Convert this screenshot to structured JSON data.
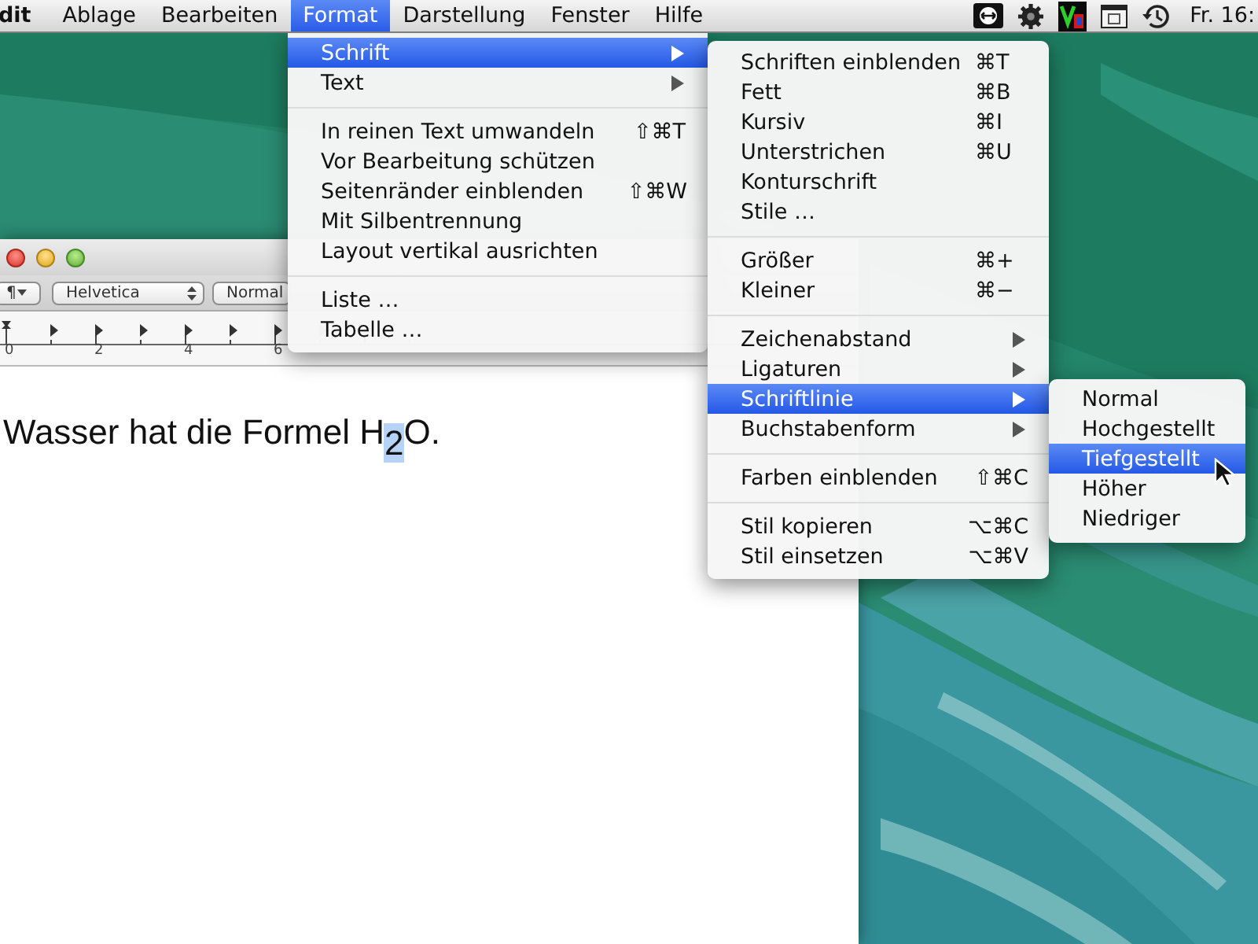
{
  "menubar": {
    "items": [
      {
        "label": "dit",
        "kind": "app",
        "selected": false
      },
      {
        "label": "Ablage",
        "kind": "menu",
        "selected": false
      },
      {
        "label": "Bearbeiten",
        "kind": "menu",
        "selected": false
      },
      {
        "label": "Format",
        "kind": "menu",
        "selected": true
      },
      {
        "label": "Darstellung",
        "kind": "menu",
        "selected": false
      },
      {
        "label": "Fenster",
        "kind": "menu",
        "selected": false
      },
      {
        "label": "Hilfe",
        "kind": "menu",
        "selected": false
      }
    ],
    "clock": "Fr. 16:"
  },
  "window": {
    "toolbar": {
      "paragraph_popup": "¶",
      "font_popup": "Helvetica",
      "style_popup": "Normal"
    },
    "ruler_labels": [
      "0",
      "2",
      "4",
      "6"
    ],
    "document": "Wasser hat die Formel H$_{2}$O."
  },
  "format_menu": [
    {
      "kind": "item",
      "label": "Schrift",
      "submenu": true,
      "selected": true
    },
    {
      "kind": "item",
      "label": "Text",
      "submenu": true,
      "selected": false
    },
    {
      "kind": "separator"
    },
    {
      "kind": "item",
      "label": "In reinen Text umwandeln",
      "shortcut": "⇧⌘T",
      "submenu": false,
      "selected": false
    },
    {
      "kind": "item",
      "label": "Vor Bearbeitung schützen",
      "submenu": false,
      "selected": false
    },
    {
      "kind": "item",
      "label": "Seitenränder einblenden",
      "shortcut": "⇧⌘W",
      "submenu": false,
      "selected": false
    },
    {
      "kind": "item",
      "label": "Mit Silbentrennung",
      "submenu": false,
      "selected": false
    },
    {
      "kind": "item",
      "label": "Layout vertikal ausrichten",
      "submenu": false,
      "selected": false
    },
    {
      "kind": "separator"
    },
    {
      "kind": "item",
      "label": "Liste …",
      "submenu": false,
      "selected": false
    },
    {
      "kind": "item",
      "label": "Tabelle …",
      "submenu": false,
      "selected": false
    }
  ],
  "schrift_menu": [
    {
      "kind": "item",
      "label": "Schriften einblenden",
      "shortcut": "⌘T",
      "submenu": false,
      "selected": false
    },
    {
      "kind": "item",
      "label": "Fett",
      "shortcut": "⌘B",
      "submenu": false,
      "selected": false
    },
    {
      "kind": "item",
      "label": "Kursiv",
      "shortcut": "⌘I",
      "submenu": false,
      "selected": false
    },
    {
      "kind": "item",
      "label": "Unterstrichen",
      "shortcut": "⌘U",
      "submenu": false,
      "selected": false
    },
    {
      "kind": "item",
      "label": "Konturschrift",
      "submenu": false,
      "selected": false
    },
    {
      "kind": "item",
      "label": "Stile …",
      "submenu": false,
      "selected": false
    },
    {
      "kind": "separator"
    },
    {
      "kind": "item",
      "label": "Größer",
      "shortcut": "⌘+",
      "submenu": false,
      "selected": false
    },
    {
      "kind": "item",
      "label": "Kleiner",
      "shortcut": "⌘−",
      "submenu": false,
      "selected": false
    },
    {
      "kind": "separator"
    },
    {
      "kind": "item",
      "label": "Zeichenabstand",
      "submenu": true,
      "selected": false
    },
    {
      "kind": "item",
      "label": "Ligaturen",
      "submenu": true,
      "selected": false
    },
    {
      "kind": "item",
      "label": "Schriftlinie",
      "submenu": true,
      "selected": true
    },
    {
      "kind": "item",
      "label": "Buchstabenform",
      "submenu": true,
      "selected": false
    },
    {
      "kind": "separator"
    },
    {
      "kind": "item",
      "label": "Farben einblenden",
      "shortcut": "⇧⌘C",
      "submenu": false,
      "selected": false
    },
    {
      "kind": "separator"
    },
    {
      "kind": "item",
      "label": "Stil kopieren",
      "shortcut": "⌥⌘C",
      "submenu": false,
      "selected": false
    },
    {
      "kind": "item",
      "label": "Stil einsetzen",
      "shortcut": "⌥⌘V",
      "submenu": false,
      "selected": false
    }
  ],
  "schriftlinie_menu": [
    {
      "kind": "item",
      "label": "Normal",
      "submenu": false,
      "selected": false
    },
    {
      "kind": "item",
      "label": "Hochgestellt",
      "submenu": false,
      "selected": false
    },
    {
      "kind": "item",
      "label": "Tiefgestellt",
      "submenu": false,
      "selected": true
    },
    {
      "kind": "item",
      "label": "Höher",
      "submenu": false,
      "selected": false
    },
    {
      "kind": "item",
      "label": "Niedriger",
      "submenu": false,
      "selected": false
    }
  ]
}
